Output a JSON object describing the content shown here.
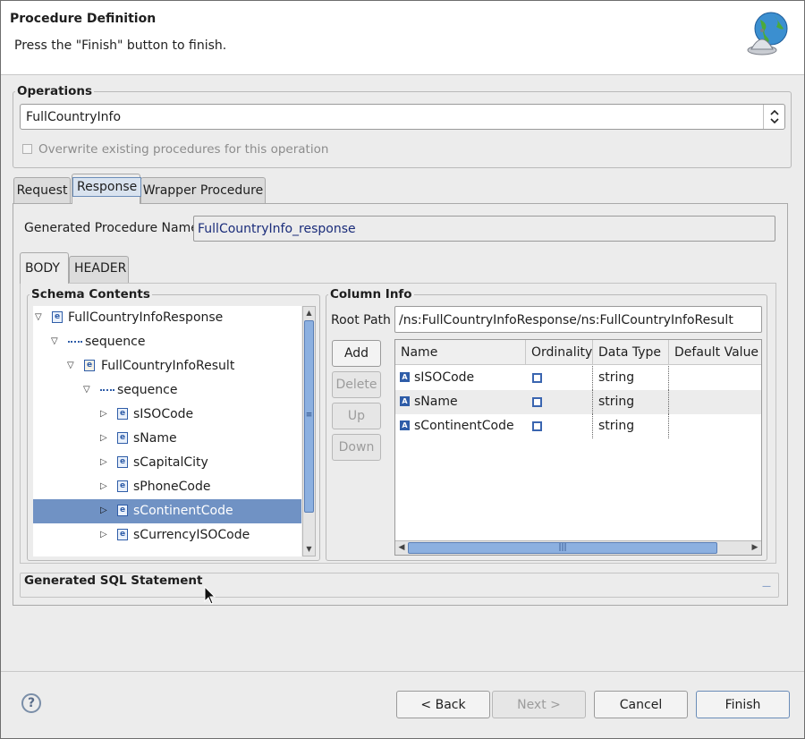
{
  "header": {
    "title": "Procedure Definition",
    "subtitle": "Press the \"Finish\" button to finish.",
    "art_icon": "globe-bell-icon"
  },
  "operations": {
    "legend": "Operations",
    "selected": "FullCountryInfo",
    "overwrite_label": "Overwrite existing procedures for this operation",
    "overwrite_checked": false
  },
  "tabs": [
    "Request",
    "Response",
    "Wrapper Procedure"
  ],
  "active_tab": "Response",
  "generated_name": {
    "label": "Generated Procedure Name",
    "value": "FullCountryInfo_response"
  },
  "subtabs": [
    "BODY",
    "HEADER"
  ],
  "active_subtab": "BODY",
  "schema": {
    "legend": "Schema Contents",
    "rows": [
      {
        "label": "FullCountryInfoResponse",
        "expander": "▽",
        "icon": "element",
        "selected": false
      },
      {
        "label": "sequence",
        "expander": "▽",
        "icon": "sequence",
        "selected": false
      },
      {
        "label": "FullCountryInfoResult",
        "expander": "▽",
        "icon": "complex-element",
        "selected": false
      },
      {
        "label": "sequence",
        "expander": "▽",
        "icon": "sequence",
        "selected": false
      },
      {
        "label": "sISOCode",
        "expander": "▷",
        "icon": "element",
        "selected": false
      },
      {
        "label": "sName",
        "expander": "▷",
        "icon": "element",
        "selected": false
      },
      {
        "label": "sCapitalCity",
        "expander": "▷",
        "icon": "element",
        "selected": false
      },
      {
        "label": "sPhoneCode",
        "expander": "▷",
        "icon": "element",
        "selected": false
      },
      {
        "label": "sContinentCode",
        "expander": "▷",
        "icon": "element",
        "selected": true
      },
      {
        "label": "sCurrencyISOCode",
        "expander": "▷",
        "icon": "element",
        "selected": false
      }
    ]
  },
  "column_info": {
    "legend": "Column Info",
    "root_path_label": "Root Path",
    "root_path": "/ns:FullCountryInfoResponse/ns:FullCountryInfoResult",
    "buttons": {
      "add": "Add",
      "delete": "Delete",
      "up": "Up",
      "down": "Down"
    },
    "columns": [
      "Name",
      "Ordinality",
      "Data Type",
      "Default Value"
    ],
    "rows": [
      {
        "name": "sISOCode",
        "ordinality": false,
        "type": "string",
        "default": ""
      },
      {
        "name": "sName",
        "ordinality": false,
        "type": "string",
        "default": ""
      },
      {
        "name": "sContinentCode",
        "ordinality": false,
        "type": "string",
        "default": ""
      }
    ]
  },
  "sql": {
    "title": "Generated SQL Statement"
  },
  "footer": {
    "back": "< Back",
    "next": "Next >",
    "cancel": "Cancel",
    "finish": "Finish"
  },
  "colors": {
    "selection": "#7092c4",
    "icon_blue": "#2f5da8",
    "name_text": "#1a2c7a"
  }
}
